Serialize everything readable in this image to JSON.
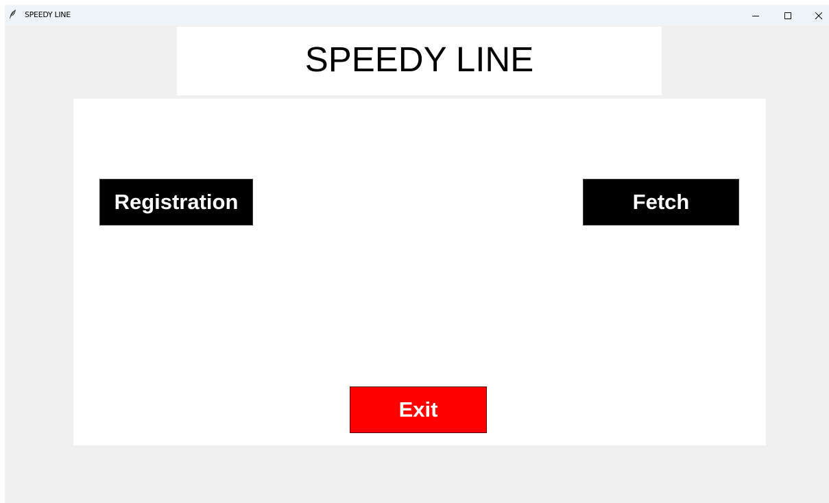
{
  "window": {
    "title": "SPEEDY LINE",
    "icon": "feather-icon",
    "controls": {
      "minimize": "minimize-icon",
      "maximize": "maximize-icon",
      "close": "close-icon"
    }
  },
  "header": {
    "title": "SPEEDY LINE"
  },
  "buttons": {
    "registration": "Registration",
    "fetch": "Fetch",
    "exit": "Exit"
  },
  "colors": {
    "primary_button": "#000000",
    "exit_button": "#ff0000",
    "button_text": "#ffffff",
    "window_background": "#f0f0f0",
    "panel_background": "#ffffff"
  }
}
